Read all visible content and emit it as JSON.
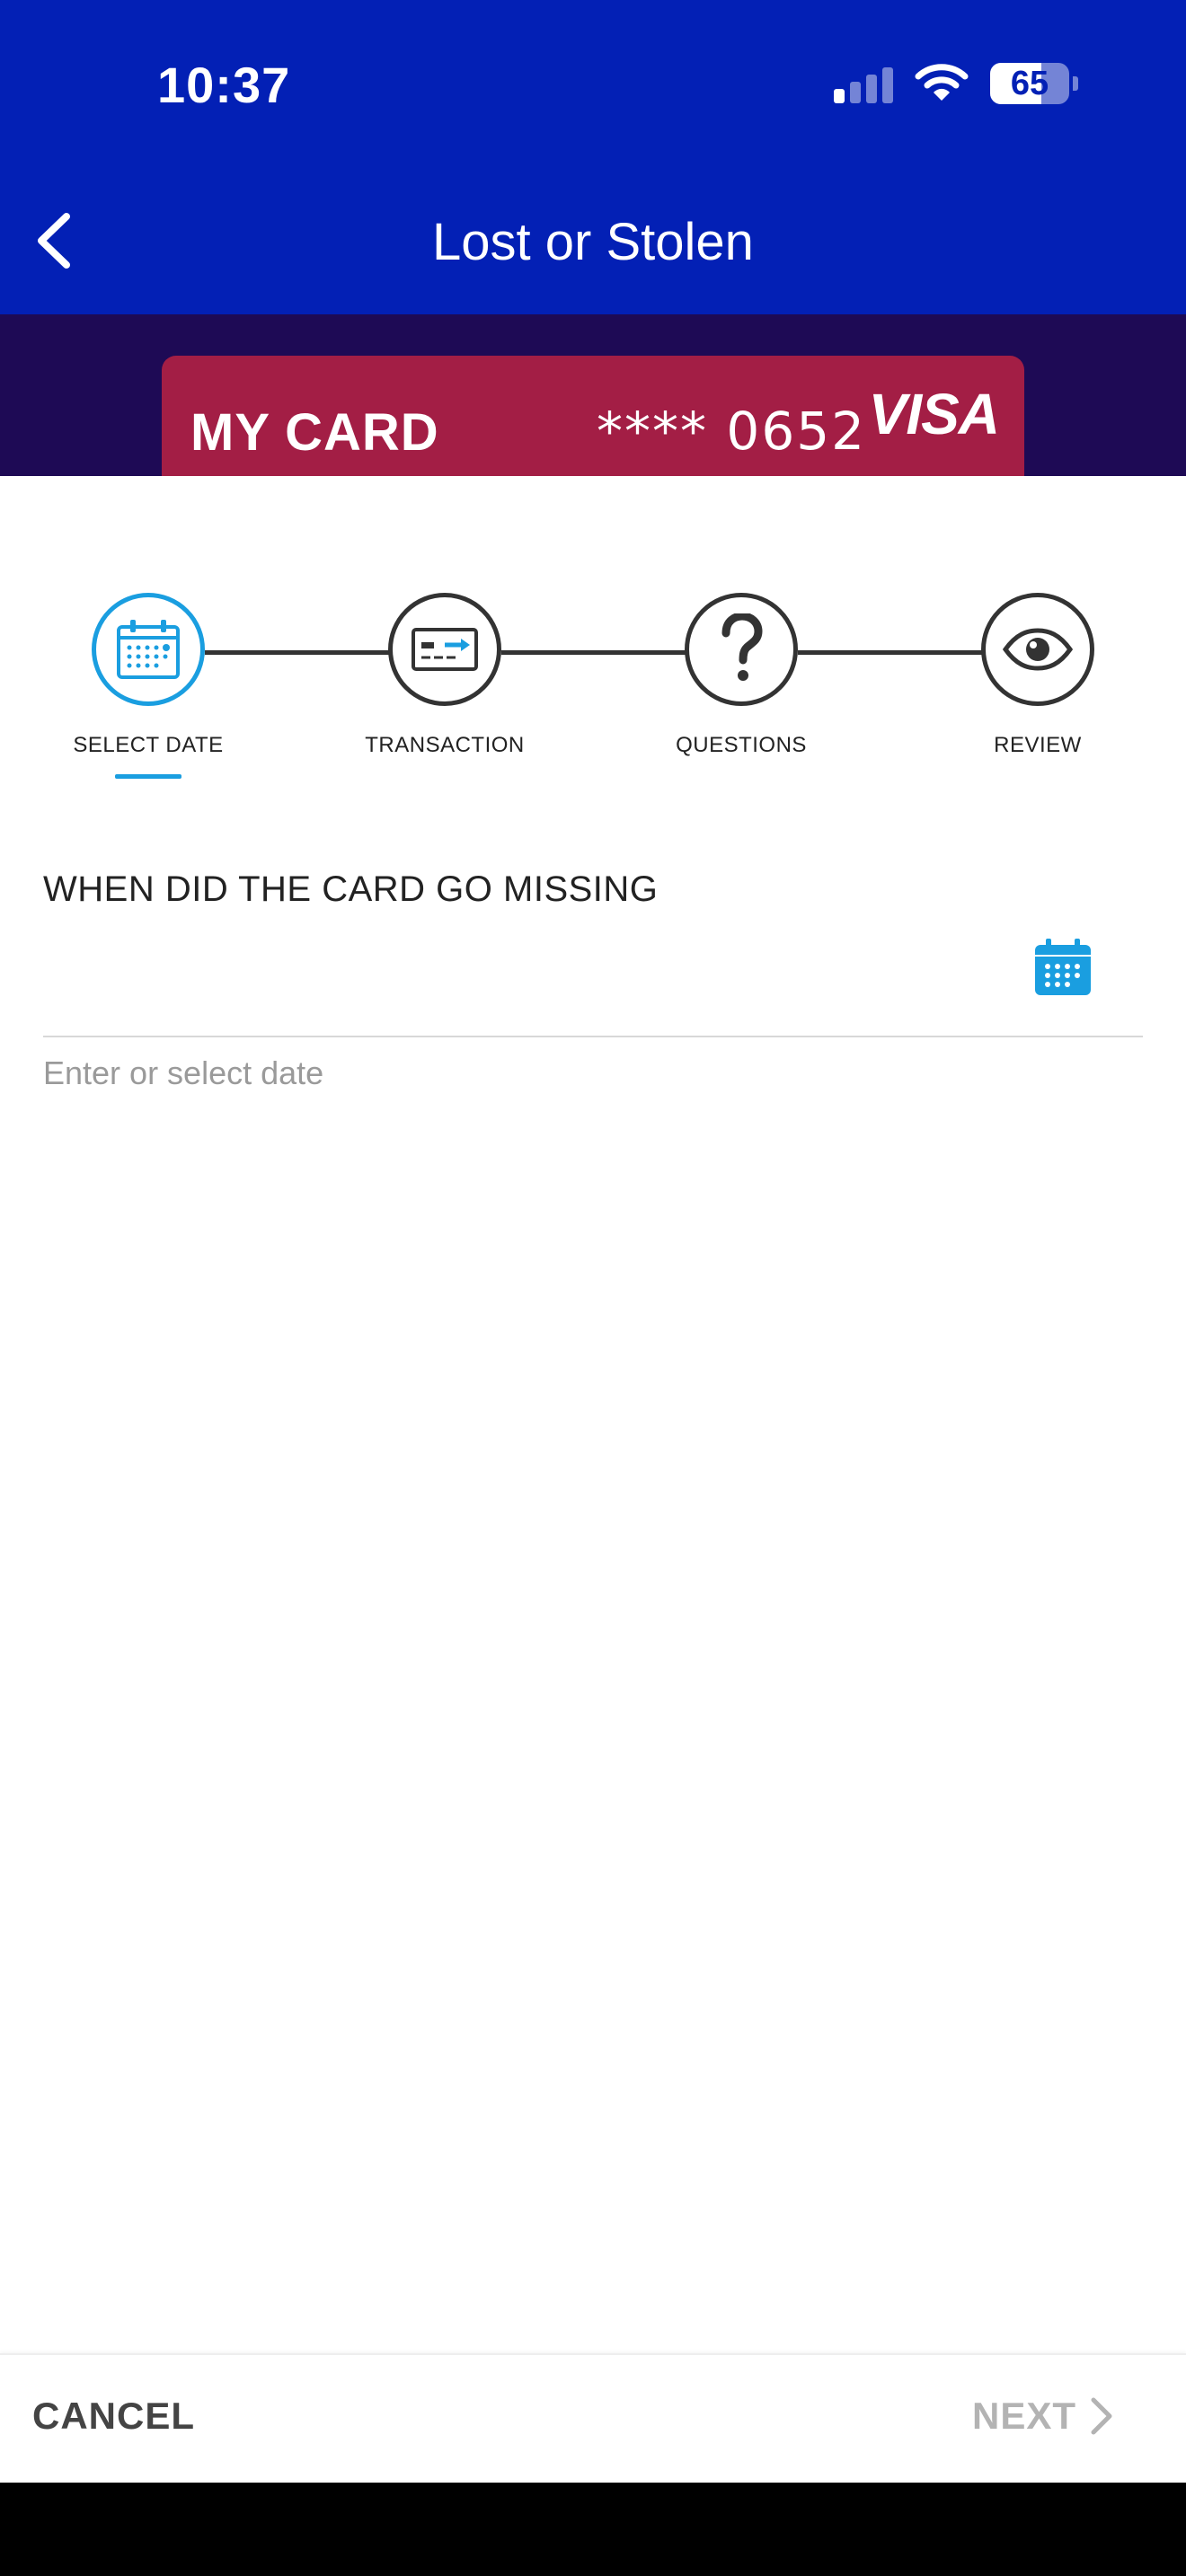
{
  "status_bar": {
    "time": "10:37",
    "battery_percent": "65",
    "battery_level": 0.65,
    "signal_bars_active": 1,
    "icons": [
      "signal-icon",
      "wifi-icon",
      "battery-icon"
    ]
  },
  "nav": {
    "title": "Lost or Stolen",
    "back_icon": "chevron-left-icon"
  },
  "card": {
    "name": "MY CARD",
    "number": "**** 0652",
    "brand": "VISA"
  },
  "stepper": {
    "steps": [
      {
        "label": "SELECT DATE",
        "icon": "calendar-icon",
        "active": true
      },
      {
        "label": "TRANSACTION",
        "icon": "credit-card-icon",
        "active": false
      },
      {
        "label": "QUESTIONS",
        "icon": "question-icon",
        "active": false
      },
      {
        "label": "REVIEW",
        "icon": "eye-icon",
        "active": false
      }
    ]
  },
  "form": {
    "label": "WHEN DID THE CARD GO MISSING",
    "value": "",
    "helper": "Enter or select date",
    "calendar_icon": "calendar-icon"
  },
  "footer": {
    "cancel_label": "CANCEL",
    "next_label": "NEXT",
    "next_icon": "chevron-right-icon"
  },
  "colors": {
    "header_blue": "#0320b5",
    "card_band": "#1e0a55",
    "card_red": "#a31e45",
    "accent": "#1a9ee0",
    "disabled": "#b3b3b3"
  }
}
